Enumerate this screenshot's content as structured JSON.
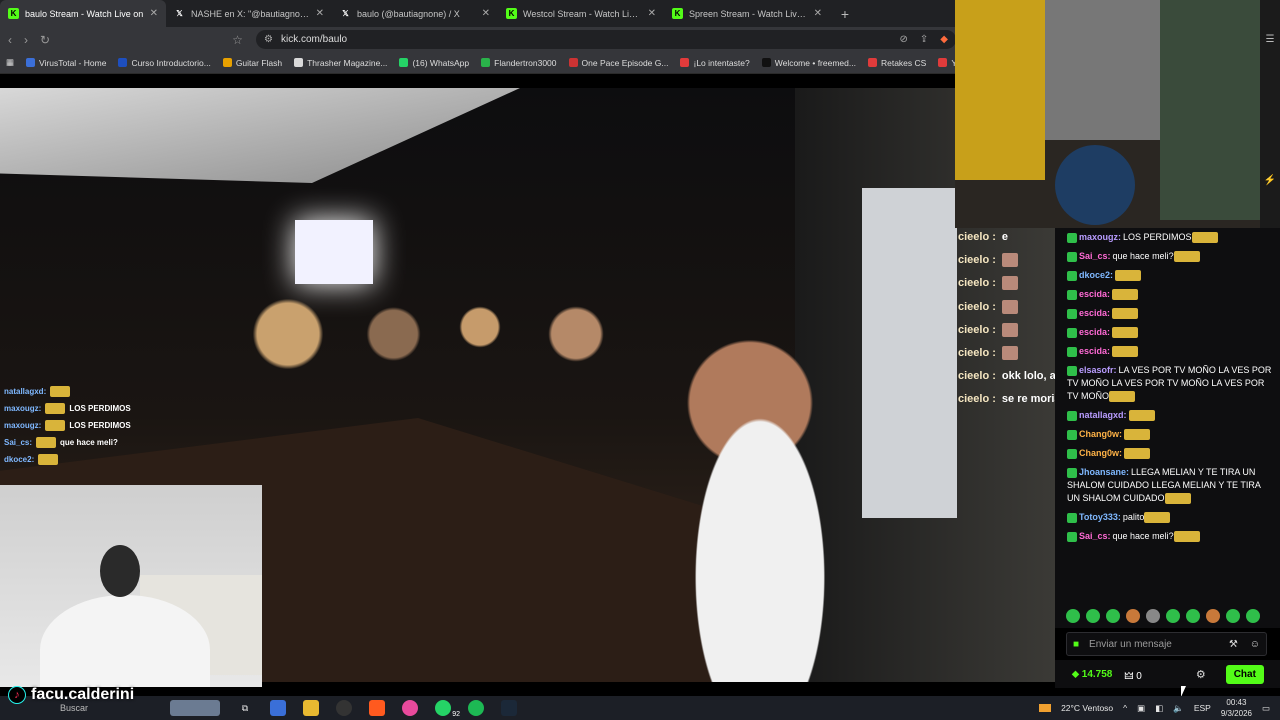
{
  "browser": {
    "tabs": [
      {
        "favicon": "kick-icon",
        "title": "baulo Stream - Watch Live on",
        "active": true,
        "color": "#53fc18"
      },
      {
        "favicon": "x-icon",
        "title": "NASHE en X: \"@bautiagnone https:/",
        "active": false,
        "color": "#ffffff"
      },
      {
        "favicon": "x-icon",
        "title": "baulo (@bautiagnone) / X",
        "active": false,
        "color": "#ffffff"
      },
      {
        "favicon": "kick-icon",
        "title": "Westcol Stream - Watch Live on",
        "active": false,
        "color": "#53fc18"
      },
      {
        "favicon": "kick-icon",
        "title": "Spreen Stream - Watch Live on K",
        "active": false,
        "color": "#53fc18"
      }
    ],
    "new_tab": "+",
    "url": "kick.com/baulo",
    "bookmarks": [
      {
        "label": "VirusTotal - Home",
        "color": "#3b6fd8"
      },
      {
        "label": "Curso Introductorio...",
        "color": "#1e4fbf"
      },
      {
        "label": "Guitar Flash",
        "color": "#e8a100"
      },
      {
        "label": "Thrasher Magazine...",
        "color": "#d9d9d9"
      },
      {
        "label": "(16) WhatsApp",
        "color": "#25d366"
      },
      {
        "label": "Flandertron3000",
        "color": "#2ab34a"
      },
      {
        "label": "One Pace Episode G...",
        "color": "#cc3333"
      },
      {
        "label": "¡Lo intentaste?",
        "color": "#e23b3b"
      },
      {
        "label": "Welcome • freemed...",
        "color": "#111111"
      },
      {
        "label": "Retakes CS",
        "color": "#e03b3b"
      },
      {
        "label": "Y",
        "color": "#e03b3b"
      }
    ]
  },
  "overlay_left": [
    {
      "user": "natallagxd:",
      "msg": ""
    },
    {
      "user": "maxougz:",
      "msg": "LOS PERDIMOS"
    },
    {
      "user": "maxougz:",
      "msg": "LOS PERDIMOS"
    },
    {
      "user": "Sai_cs:",
      "msg": "que hace meli?"
    },
    {
      "user": "dkoce2:",
      "msg": ""
    }
  ],
  "overlay_mid": [
    {
      "user": "cieelo :",
      "msg": "e"
    },
    {
      "user": "cieelo :",
      "msg": ""
    },
    {
      "user": "cieelo :",
      "msg": ""
    },
    {
      "user": "cieelo :",
      "msg": ""
    },
    {
      "user": "cieelo :",
      "msg": ""
    },
    {
      "user": "cieelo :",
      "msg": ""
    },
    {
      "user": "cieelo :",
      "msg": "okk lolo, aca nos despedimos"
    },
    {
      "user": "cieelo :",
      "msg": "se re moria"
    }
  ],
  "chat": {
    "messages": [
      {
        "user": "maxougz:",
        "color": "#b89cff",
        "text": "LOS PERDIMOS"
      },
      {
        "user": "Sai_cs:",
        "color": "#ff6ad5",
        "text": "que hace meli?"
      },
      {
        "user": "dkoce2:",
        "color": "#7fb8ff",
        "text": ""
      },
      {
        "user": "escida:",
        "color": "#ff6ad5",
        "text": ""
      },
      {
        "user": "escida:",
        "color": "#ff6ad5",
        "text": ""
      },
      {
        "user": "escida:",
        "color": "#ff6ad5",
        "text": ""
      },
      {
        "user": "escida:",
        "color": "#ff6ad5",
        "text": ""
      },
      {
        "user": "elsasofr:",
        "color": "#b89cff",
        "text": "LA VES POR TV MOÑO  LA VES POR TV MOÑO  LA VES POR TV MOÑO  LA VES POR TV MOÑO"
      },
      {
        "user": "natallagxd:",
        "color": "#b89cff",
        "text": ""
      },
      {
        "user": "Chang0w:",
        "color": "#ffb347",
        "text": ""
      },
      {
        "user": "Chang0w:",
        "color": "#ffb347",
        "text": ""
      },
      {
        "user": "Jhoansane:",
        "color": "#7fb8ff",
        "text": "LLEGA MELIAN Y TE TIRA UN SHALOM CUIDADO  LLEGA MELIAN Y TE TIRA UN SHALOM CUIDADO"
      },
      {
        "user": "Totoy333:",
        "color": "#7fb8ff",
        "text": "palito"
      },
      {
        "user": "Sai_cs:",
        "color": "#ff6ad5",
        "text": "que hace meli?"
      }
    ],
    "input_placeholder": "Enviar un mensaje",
    "points": "14.758",
    "gift_count": "0",
    "send_label": "Chat",
    "accent": "#53fc18"
  },
  "streamer_tag": "facu.calderini",
  "taskbar": {
    "search": "Buscar",
    "weather": "22°C  Ventoso",
    "lang": "ESP",
    "time": "00:43",
    "date": "9/3/2026",
    "whatsapp_badge": "92"
  }
}
